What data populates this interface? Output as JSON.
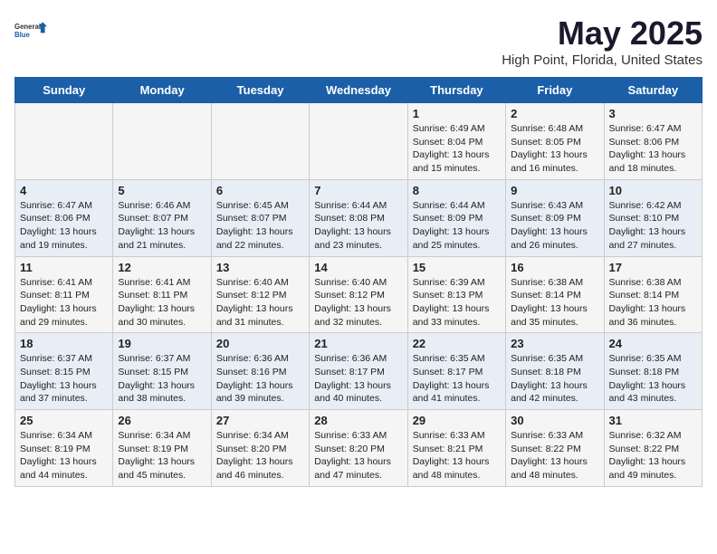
{
  "logo": {
    "general": "General",
    "blue": "Blue"
  },
  "title": "May 2025",
  "subtitle": "High Point, Florida, United States",
  "days_of_week": [
    "Sunday",
    "Monday",
    "Tuesday",
    "Wednesday",
    "Thursday",
    "Friday",
    "Saturday"
  ],
  "weeks": [
    [
      {
        "day": "",
        "content": ""
      },
      {
        "day": "",
        "content": ""
      },
      {
        "day": "",
        "content": ""
      },
      {
        "day": "",
        "content": ""
      },
      {
        "day": "1",
        "content": "Sunrise: 6:49 AM\nSunset: 8:04 PM\nDaylight: 13 hours and 15 minutes."
      },
      {
        "day": "2",
        "content": "Sunrise: 6:48 AM\nSunset: 8:05 PM\nDaylight: 13 hours and 16 minutes."
      },
      {
        "day": "3",
        "content": "Sunrise: 6:47 AM\nSunset: 8:06 PM\nDaylight: 13 hours and 18 minutes."
      }
    ],
    [
      {
        "day": "4",
        "content": "Sunrise: 6:47 AM\nSunset: 8:06 PM\nDaylight: 13 hours and 19 minutes."
      },
      {
        "day": "5",
        "content": "Sunrise: 6:46 AM\nSunset: 8:07 PM\nDaylight: 13 hours and 21 minutes."
      },
      {
        "day": "6",
        "content": "Sunrise: 6:45 AM\nSunset: 8:07 PM\nDaylight: 13 hours and 22 minutes."
      },
      {
        "day": "7",
        "content": "Sunrise: 6:44 AM\nSunset: 8:08 PM\nDaylight: 13 hours and 23 minutes."
      },
      {
        "day": "8",
        "content": "Sunrise: 6:44 AM\nSunset: 8:09 PM\nDaylight: 13 hours and 25 minutes."
      },
      {
        "day": "9",
        "content": "Sunrise: 6:43 AM\nSunset: 8:09 PM\nDaylight: 13 hours and 26 minutes."
      },
      {
        "day": "10",
        "content": "Sunrise: 6:42 AM\nSunset: 8:10 PM\nDaylight: 13 hours and 27 minutes."
      }
    ],
    [
      {
        "day": "11",
        "content": "Sunrise: 6:41 AM\nSunset: 8:11 PM\nDaylight: 13 hours and 29 minutes."
      },
      {
        "day": "12",
        "content": "Sunrise: 6:41 AM\nSunset: 8:11 PM\nDaylight: 13 hours and 30 minutes."
      },
      {
        "day": "13",
        "content": "Sunrise: 6:40 AM\nSunset: 8:12 PM\nDaylight: 13 hours and 31 minutes."
      },
      {
        "day": "14",
        "content": "Sunrise: 6:40 AM\nSunset: 8:12 PM\nDaylight: 13 hours and 32 minutes."
      },
      {
        "day": "15",
        "content": "Sunrise: 6:39 AM\nSunset: 8:13 PM\nDaylight: 13 hours and 33 minutes."
      },
      {
        "day": "16",
        "content": "Sunrise: 6:38 AM\nSunset: 8:14 PM\nDaylight: 13 hours and 35 minutes."
      },
      {
        "day": "17",
        "content": "Sunrise: 6:38 AM\nSunset: 8:14 PM\nDaylight: 13 hours and 36 minutes."
      }
    ],
    [
      {
        "day": "18",
        "content": "Sunrise: 6:37 AM\nSunset: 8:15 PM\nDaylight: 13 hours and 37 minutes."
      },
      {
        "day": "19",
        "content": "Sunrise: 6:37 AM\nSunset: 8:15 PM\nDaylight: 13 hours and 38 minutes."
      },
      {
        "day": "20",
        "content": "Sunrise: 6:36 AM\nSunset: 8:16 PM\nDaylight: 13 hours and 39 minutes."
      },
      {
        "day": "21",
        "content": "Sunrise: 6:36 AM\nSunset: 8:17 PM\nDaylight: 13 hours and 40 minutes."
      },
      {
        "day": "22",
        "content": "Sunrise: 6:35 AM\nSunset: 8:17 PM\nDaylight: 13 hours and 41 minutes."
      },
      {
        "day": "23",
        "content": "Sunrise: 6:35 AM\nSunset: 8:18 PM\nDaylight: 13 hours and 42 minutes."
      },
      {
        "day": "24",
        "content": "Sunrise: 6:35 AM\nSunset: 8:18 PM\nDaylight: 13 hours and 43 minutes."
      }
    ],
    [
      {
        "day": "25",
        "content": "Sunrise: 6:34 AM\nSunset: 8:19 PM\nDaylight: 13 hours and 44 minutes."
      },
      {
        "day": "26",
        "content": "Sunrise: 6:34 AM\nSunset: 8:19 PM\nDaylight: 13 hours and 45 minutes."
      },
      {
        "day": "27",
        "content": "Sunrise: 6:34 AM\nSunset: 8:20 PM\nDaylight: 13 hours and 46 minutes."
      },
      {
        "day": "28",
        "content": "Sunrise: 6:33 AM\nSunset: 8:20 PM\nDaylight: 13 hours and 47 minutes."
      },
      {
        "day": "29",
        "content": "Sunrise: 6:33 AM\nSunset: 8:21 PM\nDaylight: 13 hours and 48 minutes."
      },
      {
        "day": "30",
        "content": "Sunrise: 6:33 AM\nSunset: 8:22 PM\nDaylight: 13 hours and 48 minutes."
      },
      {
        "day": "31",
        "content": "Sunrise: 6:32 AM\nSunset: 8:22 PM\nDaylight: 13 hours and 49 minutes."
      }
    ]
  ]
}
